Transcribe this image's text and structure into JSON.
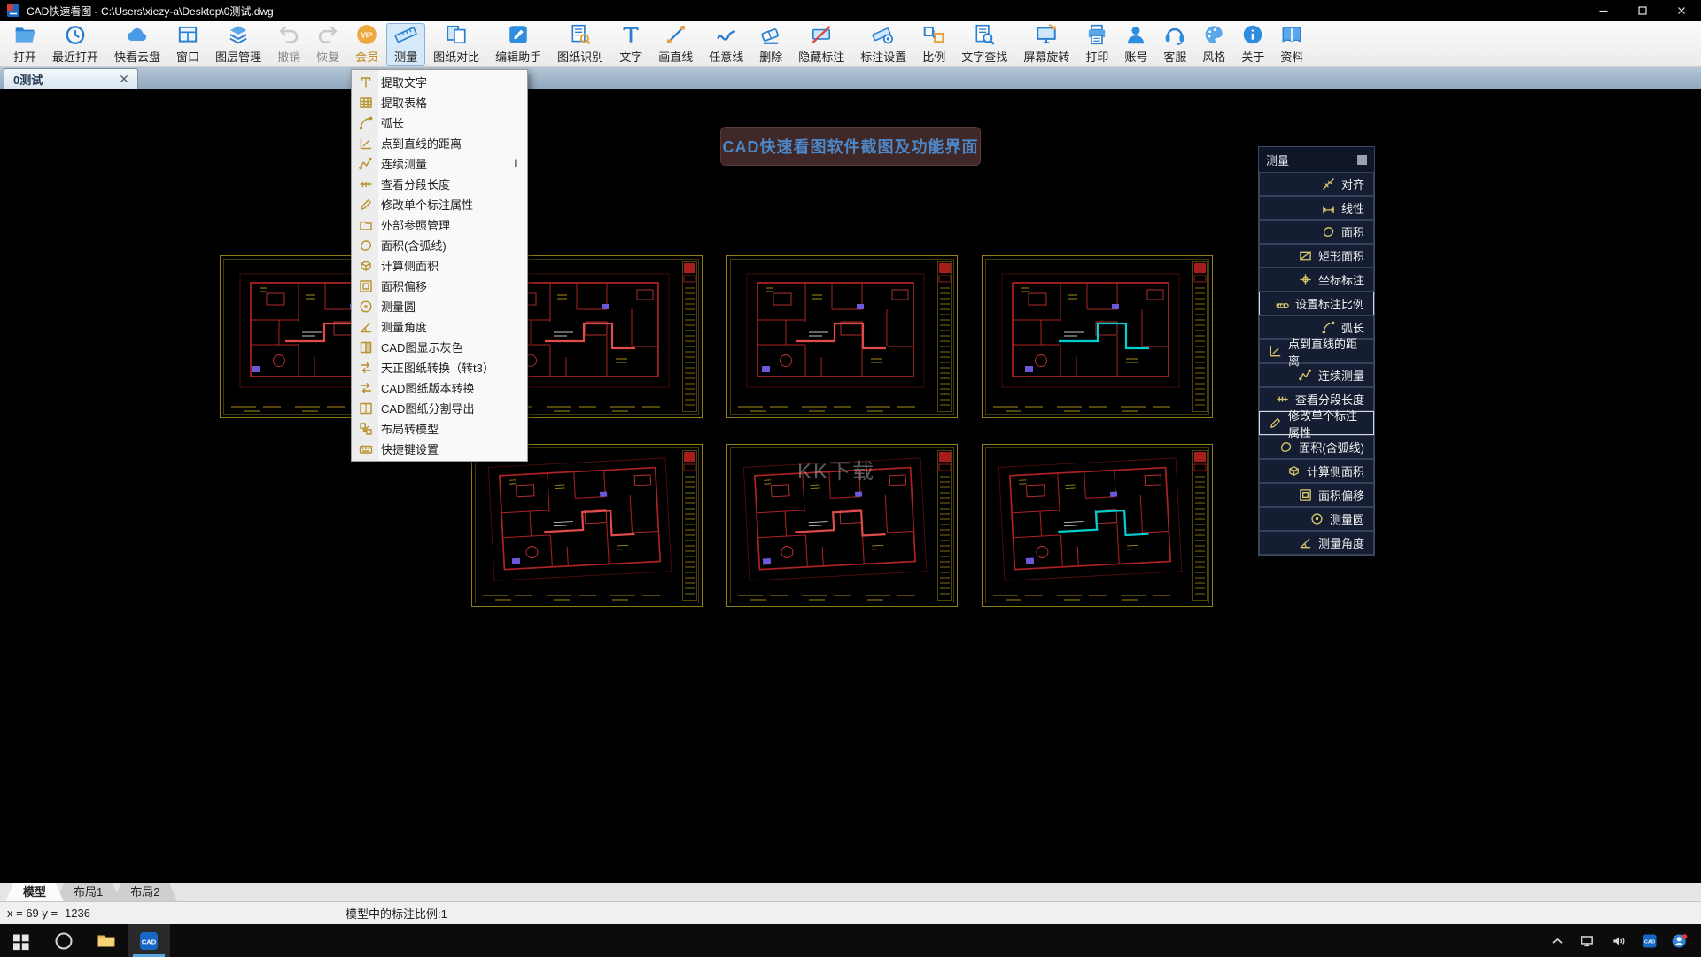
{
  "window": {
    "title": "CAD快速看图 - C:\\Users\\xiezy-a\\Desktop\\0测试.dwg"
  },
  "doc_tab": {
    "label": "0测试"
  },
  "toolbar": {
    "items": [
      {
        "id": "open",
        "icon": "folder-open",
        "label": "打开"
      },
      {
        "id": "recent-open",
        "icon": "clock",
        "label": "最近打开"
      },
      {
        "id": "cloud-drive",
        "icon": "cloud",
        "label": "快看云盘"
      },
      {
        "id": "window",
        "icon": "window",
        "label": "窗口"
      },
      {
        "id": "layer-manager",
        "icon": "layers",
        "label": "图层管理"
      },
      {
        "id": "undo",
        "icon": "undo-arrow",
        "label": "撤销",
        "disabled": true
      },
      {
        "id": "redo",
        "icon": "redo-arrow",
        "label": "恢复",
        "disabled": true
      },
      {
        "id": "vip-member",
        "icon": "vip-badge",
        "label": "会员",
        "gold": true
      },
      {
        "id": "measure",
        "icon": "ruler",
        "label": "测量",
        "active": true
      },
      {
        "id": "drawing-compare",
        "icon": "compare",
        "label": "图纸对比"
      },
      {
        "id": "edit-assistant",
        "icon": "pencil-square",
        "label": "编辑助手"
      },
      {
        "id": "drawing-recognize",
        "icon": "doc-magnifier",
        "label": "图纸识别"
      },
      {
        "id": "text",
        "icon": "text-T",
        "label": "文字"
      },
      {
        "id": "draw-line",
        "icon": "line",
        "label": "画直线"
      },
      {
        "id": "free-line",
        "icon": "curve",
        "label": "任意线"
      },
      {
        "id": "delete",
        "icon": "eraser",
        "label": "删除"
      },
      {
        "id": "hide-annotation",
        "icon": "tag-slash",
        "label": "隐藏标注"
      },
      {
        "id": "annotation-settings",
        "icon": "ruler-gear",
        "label": "标注设置"
      },
      {
        "id": "scale",
        "icon": "ratio",
        "label": "比例"
      },
      {
        "id": "text-search",
        "icon": "doc-search",
        "label": "文字查找"
      },
      {
        "id": "screen-rotate",
        "icon": "monitor-rotate",
        "label": "屏幕旋转"
      },
      {
        "id": "print",
        "icon": "printer",
        "label": "打印"
      },
      {
        "id": "account",
        "icon": "person",
        "label": "账号"
      },
      {
        "id": "customer-service",
        "icon": "headset",
        "label": "客服"
      },
      {
        "id": "style",
        "icon": "palette",
        "label": "风格"
      },
      {
        "id": "about",
        "icon": "info-circle",
        "label": "关于"
      },
      {
        "id": "docs",
        "icon": "book",
        "label": "资料"
      }
    ]
  },
  "measure_menu": {
    "items": [
      {
        "id": "extract-text",
        "icon": "text-extract",
        "label": "提取文字"
      },
      {
        "id": "extract-table",
        "icon": "table",
        "label": "提取表格"
      },
      {
        "id": "arc-length",
        "icon": "arc",
        "label": "弧长"
      },
      {
        "id": "point-line-distance",
        "icon": "distance",
        "label": "点到直线的距离"
      },
      {
        "id": "continuous-measure",
        "icon": "chain",
        "label": "连续测量",
        "shortcut": "L"
      },
      {
        "id": "view-segment-length",
        "icon": "segments",
        "label": "查看分段长度"
      },
      {
        "id": "modify-single-annotation",
        "icon": "edit-pencil",
        "label": "修改单个标注属性"
      },
      {
        "id": "external-reference",
        "icon": "folder",
        "label": "外部参照管理"
      },
      {
        "id": "area-with-arc",
        "icon": "area-arc",
        "label": "面积(含弧线)"
      },
      {
        "id": "side-area",
        "icon": "cube",
        "label": "计算侧面积"
      },
      {
        "id": "area-offset",
        "icon": "offset",
        "label": "面积偏移"
      },
      {
        "id": "measure-circle",
        "icon": "circle",
        "label": "测量圆"
      },
      {
        "id": "measure-angle",
        "icon": "angle",
        "label": "测量角度"
      },
      {
        "id": "cad-gray-display",
        "icon": "gray-toggle",
        "label": "CAD图显示灰色"
      },
      {
        "id": "tianzheng-convert",
        "icon": "convert",
        "label": "天正图纸转换（转t3）"
      },
      {
        "id": "version-convert",
        "icon": "convert",
        "label": "CAD图纸版本转换"
      },
      {
        "id": "split-export",
        "icon": "split-export",
        "label": "CAD图纸分割导出"
      },
      {
        "id": "layout-to-model",
        "icon": "layout-model",
        "label": "布局转模型"
      },
      {
        "id": "hotkey-settings",
        "icon": "hotkey",
        "label": "快捷键设置"
      }
    ]
  },
  "measure_panel": {
    "title": "测量",
    "items": [
      {
        "id": "align",
        "icon": "align",
        "label": "对齐"
      },
      {
        "id": "linear",
        "icon": "linear",
        "label": "线性"
      },
      {
        "id": "area",
        "icon": "area-arc",
        "label": "面积"
      },
      {
        "id": "rect-area",
        "icon": "rect-area",
        "label": "矩形面积"
      },
      {
        "id": "coord-annotation",
        "icon": "coord",
        "label": "坐标标注"
      },
      {
        "id": "set-annotation-scale",
        "icon": "scale-set",
        "label": "设置标注比例",
        "boxed": true
      },
      {
        "id": "arc-length",
        "icon": "arc",
        "label": "弧长"
      },
      {
        "id": "point-line-distance",
        "icon": "distance",
        "label": "点到直线的距离"
      },
      {
        "id": "continuous-measure",
        "icon": "chain",
        "label": "连续测量"
      },
      {
        "id": "view-segment-length",
        "icon": "segments",
        "label": "查看分段长度"
      },
      {
        "id": "modify-single-annotation",
        "icon": "edit-pencil",
        "label": "修改单个标注属性",
        "boxed": true
      },
      {
        "id": "area-with-arc",
        "icon": "area-arc",
        "label": "面积(含弧线)"
      },
      {
        "id": "side-area",
        "icon": "cube",
        "label": "计算侧面积"
      },
      {
        "id": "area-offset",
        "icon": "offset",
        "label": "面积偏移"
      },
      {
        "id": "measure-circle",
        "icon": "circle",
        "label": "测量圆"
      },
      {
        "id": "measure-angle",
        "icon": "angle",
        "label": "测量角度"
      }
    ]
  },
  "canvas": {
    "banner": "CAD快速看图软件截图及功能界面",
    "watermark": "KK下载"
  },
  "layout_tabs": [
    {
      "id": "model",
      "label": "模型",
      "active": true
    },
    {
      "id": "layout1",
      "label": "布局1"
    },
    {
      "id": "layout2",
      "label": "布局2"
    }
  ],
  "status_bar": {
    "coords": "x = 69 y = -1236",
    "scale_info": "模型中的标注比例:1"
  },
  "taskbar": {
    "cad_label": "CAD",
    "apps": [
      {
        "id": "start",
        "icon": "windows"
      },
      {
        "id": "cortana",
        "icon": "circle-ring"
      },
      {
        "id": "file-explorer",
        "icon": "folder-task"
      },
      {
        "id": "cad-app",
        "icon": "cad-app",
        "active": true
      }
    ],
    "tray": [
      {
        "id": "tray-expand",
        "icon": "chevron-up"
      },
      {
        "id": "network",
        "icon": "network"
      },
      {
        "id": "volume",
        "icon": "speaker"
      },
      {
        "id": "tray-cad",
        "icon": "cad-app"
      },
      {
        "id": "account",
        "icon": "avatar-badge"
      }
    ]
  },
  "colors": {
    "toolbar_icon_blue": "#2b7fd0",
    "vip_gold": "#ecaa3e",
    "banner_bg": "#3f2827",
    "banner_text": "#4c86c6",
    "drawing_border_yellow": "#8f7f14",
    "drawing_wall_red": "#ad2222",
    "accent_red": "#e04c4c",
    "accent_cyan": "#00cfcf",
    "menu_icon_gold": "#b8922a",
    "panel_icon_gold": "#d8c86a"
  }
}
